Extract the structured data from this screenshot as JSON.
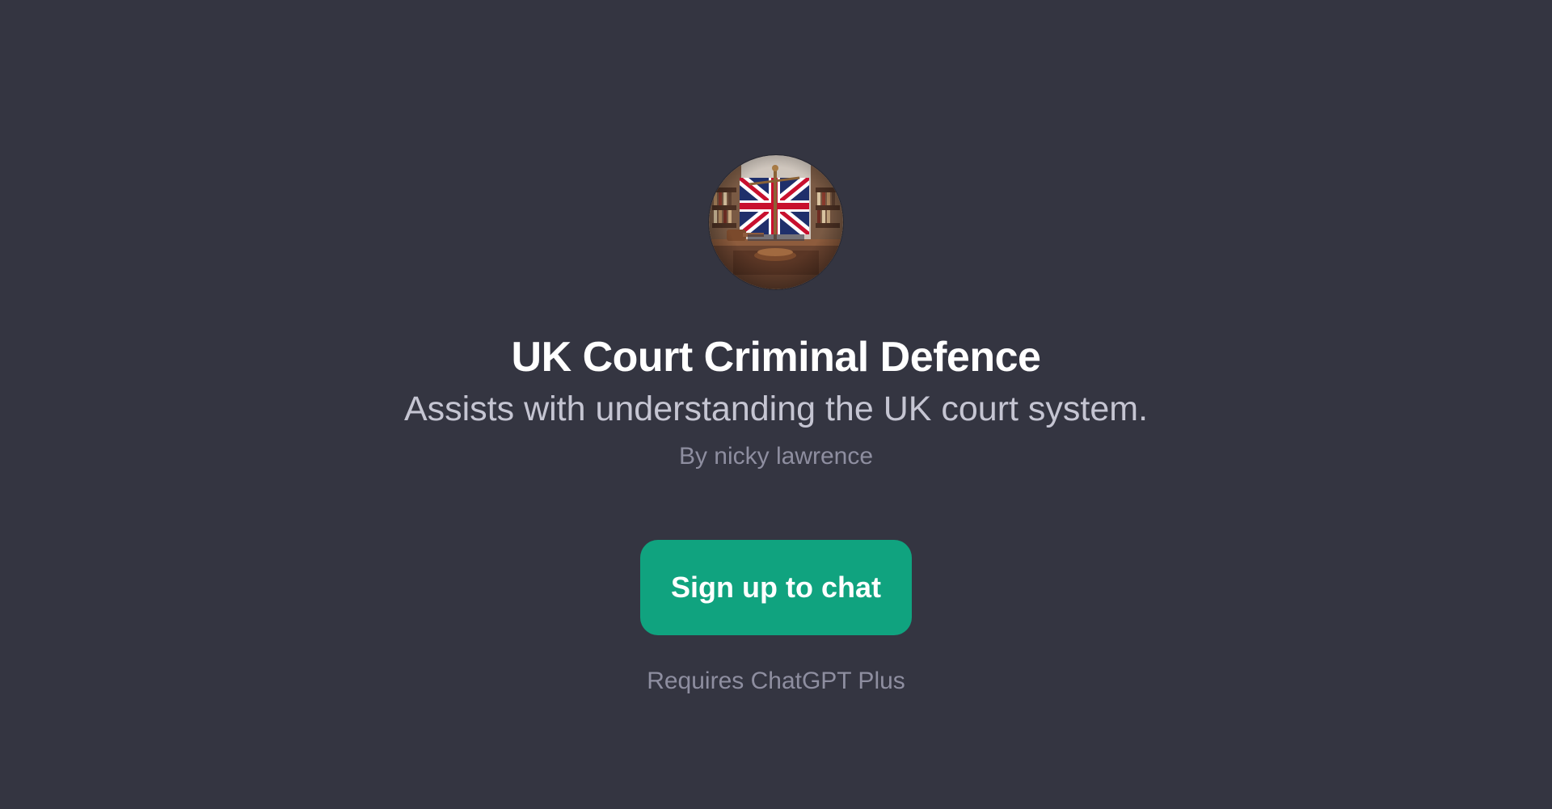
{
  "gpt": {
    "avatar_icon": "uk-court-flag-gavel-image",
    "title": "UK Court Criminal Defence",
    "description": "Assists with understanding the UK court system.",
    "author": "By nicky lawrence"
  },
  "cta": {
    "signup_label": "Sign up to chat",
    "requirement": "Requires ChatGPT Plus"
  },
  "colors": {
    "background": "#343541",
    "accent": "#10a37f",
    "title": "#ffffff",
    "description": "#c5c5d2",
    "muted": "#8e8ea0"
  }
}
